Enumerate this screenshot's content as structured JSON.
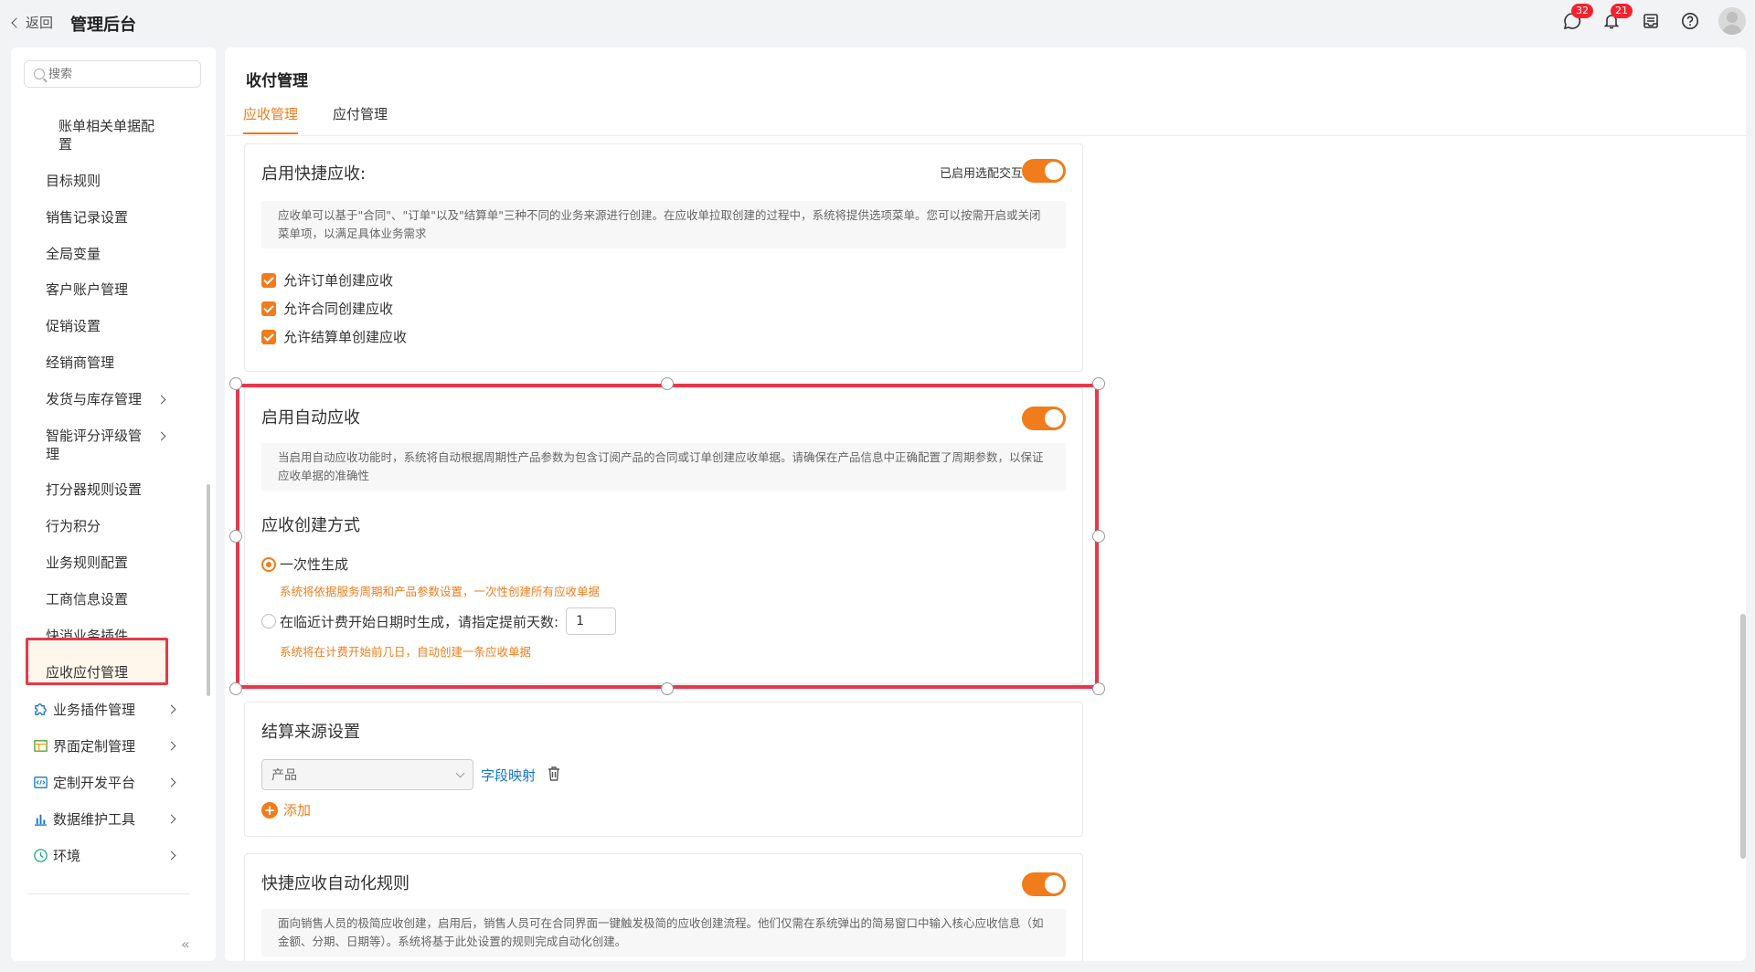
{
  "header": {
    "back_label": "返回",
    "app_title": "管理后台",
    "messages_badge": "32",
    "notifications_badge": "21"
  },
  "sidebar": {
    "search_placeholder": "搜索",
    "items": [
      {
        "label_line1": "账单相关单据配",
        "label_line2": "置"
      },
      {
        "label": "目标规则"
      },
      {
        "label": "销售记录设置"
      },
      {
        "label": "全局变量"
      },
      {
        "label": "客户账户管理"
      },
      {
        "label": "促销设置"
      },
      {
        "label": "经销商管理"
      },
      {
        "label": "发货与库存管理"
      },
      {
        "label_line1": "智能评分评级管",
        "label_line2": "理"
      },
      {
        "label": "打分器规则设置"
      },
      {
        "label": "行为积分"
      },
      {
        "label": "业务规则配置"
      },
      {
        "label": "工商信息设置"
      },
      {
        "label": "快消业务插件"
      },
      {
        "label": "应收应付管理"
      }
    ],
    "groups": [
      {
        "label": "业务插件管理",
        "icon": "puzzle-icon"
      },
      {
        "label": "界面定制管理",
        "icon": "layout-icon"
      },
      {
        "label": "定制开发平台",
        "icon": "code-icon"
      },
      {
        "label": "数据维护工具",
        "icon": "bar-chart-icon"
      },
      {
        "label": "环境",
        "icon": "environment-icon"
      }
    ],
    "collapse_glyph": "«"
  },
  "main": {
    "title": "收付管理",
    "tabs": [
      {
        "label": "应收管理",
        "active": true
      },
      {
        "label": "应付管理",
        "active": false
      }
    ],
    "card_quick": {
      "title": "启用快捷应收:",
      "toggle_label": "已启用选配交互",
      "toggle_on": true,
      "desc": "应收单可以基于\"合同\"、\"订单\"以及\"结算单\"三种不同的业务来源进行创建。在应收单拉取创建的过程中，系统将提供选项菜单。您可以按需开启或关闭菜单项，以满足具体业务需求",
      "checkboxes": [
        {
          "label": "允许订单创建应收",
          "checked": true
        },
        {
          "label": "允许合同创建应收",
          "checked": true
        },
        {
          "label": "允许结算单创建应收",
          "checked": true
        }
      ]
    },
    "card_auto": {
      "title": "启用自动应收",
      "toggle_on": true,
      "desc": "当启用自动应收功能时，系统将自动根据周期性产品参数为包含订阅产品的合同或订单创建应收单据。请确保在产品信息中正确配置了周期参数，以保证应收单据的准确性",
      "section_title": "应收创建方式",
      "option1_label": "一次性生成",
      "option1_hint": "系统将依据服务周期和产品参数设置，一次性创建所有应收单据",
      "option2_label": "在临近计费开始日期时生成，请指定提前天数:",
      "option2_value": "1",
      "option2_hint": "系统将在计费开始前几日，自动创建一条应收单据",
      "selected_option": 1
    },
    "card_source": {
      "title": "结算来源设置",
      "select_value": "产品",
      "field_mapping_link": "字段映射",
      "add_label": "添加"
    },
    "card_rules": {
      "title": "快捷应收自动化规则",
      "toggle_on": true,
      "desc": "面向销售人员的极简应收创建，启用后，销售人员可在合同界面一键触发极简的应收创建流程。他们仅需在系统弹出的简易窗口中输入核心应收信息（如金额、分期、日期等）。系统将基于此处设置的规则完成自动化创建。"
    }
  },
  "colors": {
    "accent": "#f07c1c",
    "highlight": "#e5394b",
    "link": "#1677c8"
  }
}
